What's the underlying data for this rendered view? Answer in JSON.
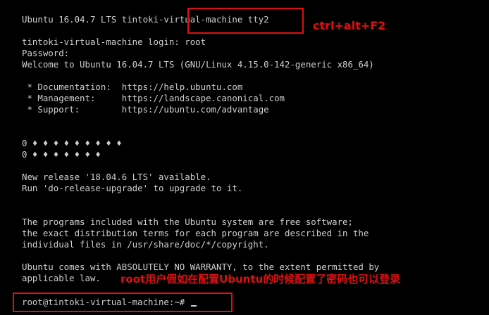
{
  "terminal": {
    "header": "Ubuntu 16.04.7 LTS tintoki-virtual-machine tty2",
    "login": "tintoki-virtual-machine login: root",
    "password": "Password:",
    "welcome": "Welcome to Ubuntu 16.04.7 LTS (GNU/Linux 4.15.0-142-generic x86_64)",
    "doc": " * Documentation:  https://help.ubuntu.com",
    "mgmt": " * Management:     https://landscape.canonical.com",
    "support": " * Support:        https://ubuntu.com/advantage",
    "garbled1": "0 ♦ ♦ ♦ ♦ ♦ ♦ ♦ ♦ ♦",
    "garbled2": "0 ♦ ♦ ♦ ♦ ♦ ♦ ♦",
    "release1": "New release '18.04.6 LTS' available.",
    "release2": "Run 'do-release-upgrade' to upgrade to it.",
    "free1": "The programs included with the Ubuntu system are free software;",
    "free2": "the exact distribution terms for each program are described in the",
    "free3": "individual files in /usr/share/doc/*/copyright.",
    "warranty1": "Ubuntu comes with ABSOLUTELY NO WARRANTY, to the extent permitted by",
    "warranty2": "applicable law.",
    "prompt": "root@tintoki-virtual-machine:~# "
  },
  "annotations": {
    "keys": "ctrl+alt+F2",
    "note": "root用户假如在配置Ubuntu的时候配置了密码也可以登录"
  },
  "colors": {
    "background": "#000000",
    "text": "#cfcfcf",
    "annotation": "#e01010"
  }
}
